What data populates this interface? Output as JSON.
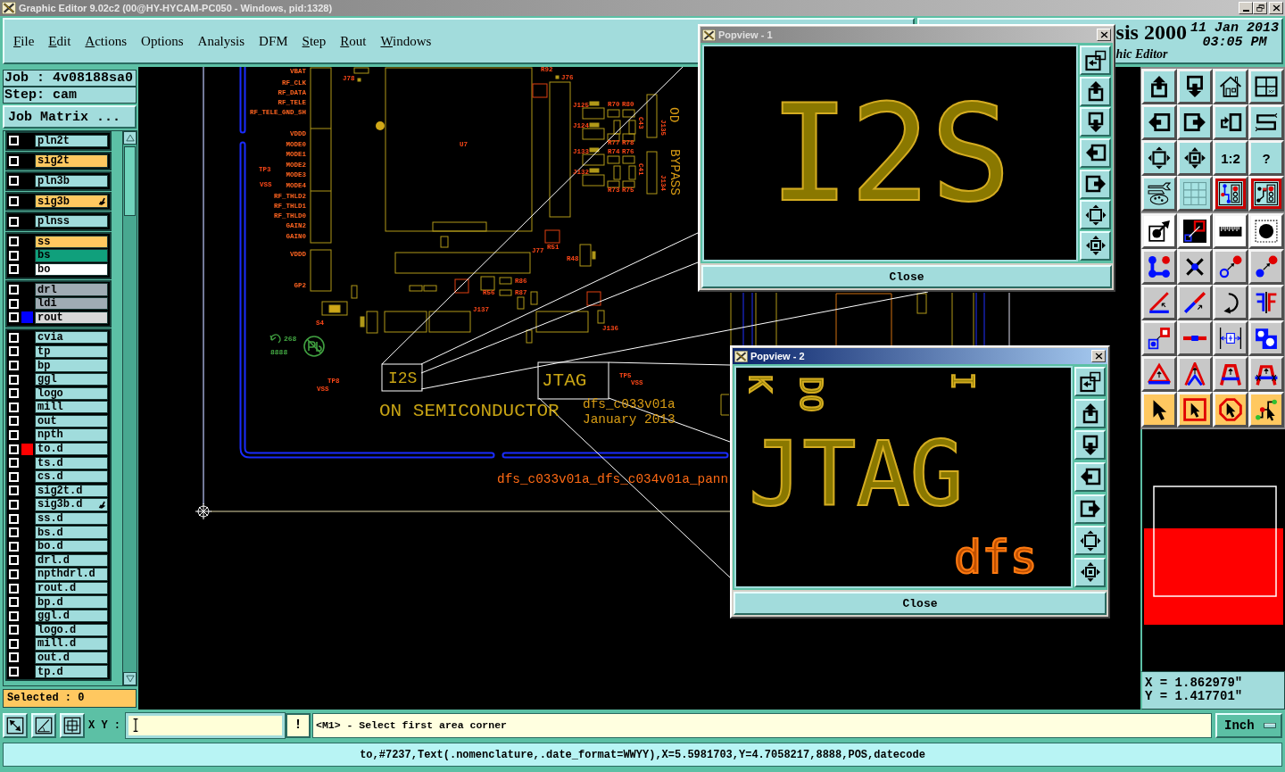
{
  "window": {
    "title": "Graphic Editor 9.02c2 (00@HY-HYCAM-PC050 - Windows, pid:1328)"
  },
  "menu": [
    {
      "label": "File",
      "mnemonic": true
    },
    {
      "label": "Edit",
      "mnemonic": true
    },
    {
      "label": "Actions",
      "mnemonic": true
    },
    {
      "label": "Options",
      "mnemonic": false
    },
    {
      "label": "Analysis",
      "mnemonic": false
    },
    {
      "label": "DFM",
      "mnemonic": false
    },
    {
      "label": "Step",
      "mnemonic": true
    },
    {
      "label": "Rout",
      "mnemonic": true
    },
    {
      "label": "Windows",
      "mnemonic": true
    }
  ],
  "branding": {
    "product": "sis 2000",
    "subtitle": "hic Editor",
    "date": "11 Jan 2013",
    "time": "03:05 PM"
  },
  "job_panel": {
    "job": "Job : 4v08188sa0",
    "step": "Step: cam",
    "matrix_button": "Job Matrix ..."
  },
  "layer_groups": [
    {
      "layers": [
        {
          "name": "pln2t",
          "color": "#a0dcdc",
          "checked": false,
          "marked": false
        }
      ]
    },
    {
      "layers": [
        {
          "name": "sig2t",
          "color": "#ffc860",
          "checked": false,
          "marked": false
        }
      ]
    },
    {
      "layers": [
        {
          "name": "pln3b",
          "color": "#a0dcdc",
          "checked": false,
          "marked": false
        }
      ]
    },
    {
      "layers": [
        {
          "name": "sig3b",
          "color": "#ffc860",
          "checked": false,
          "marked": true
        }
      ]
    },
    {
      "layers": [
        {
          "name": "plnss",
          "color": "#a0dcdc",
          "checked": false,
          "marked": false
        }
      ]
    },
    {
      "layers": [
        {
          "name": "ss",
          "color": "#ffc860",
          "checked": false,
          "marked": false
        },
        {
          "name": "bs",
          "color": "#10a07c",
          "checked": false,
          "marked": false
        },
        {
          "name": "bo",
          "color": "#ffffff",
          "checked": false,
          "marked": false
        }
      ]
    },
    {
      "layers": [
        {
          "name": "drl",
          "color": "#a0acb4",
          "checked": false,
          "marked": false
        },
        {
          "name": "ldi",
          "color": "#a0acb4",
          "checked": false,
          "marked": false
        },
        {
          "name": "rout",
          "color": "#d8d8d8",
          "checked": false,
          "marked": false,
          "swatch": {
            "color": "#0000ff"
          }
        }
      ]
    },
    {
      "layers": [
        {
          "name": "cvia",
          "color": "#a0dcdc",
          "checked": false,
          "marked": false
        },
        {
          "name": "tp",
          "color": "#a0dcdc",
          "checked": false,
          "marked": false
        },
        {
          "name": "bp",
          "color": "#a0dcdc",
          "checked": false,
          "marked": false
        },
        {
          "name": "ggl",
          "color": "#a0dcdc",
          "checked": false,
          "marked": false
        },
        {
          "name": "logo",
          "color": "#a0dcdc",
          "checked": false,
          "marked": false
        },
        {
          "name": "mill",
          "color": "#a0dcdc",
          "checked": false,
          "marked": false
        },
        {
          "name": "out",
          "color": "#a0dcdc",
          "checked": false,
          "marked": false
        },
        {
          "name": "npth",
          "color": "#a0dcdc",
          "checked": false,
          "marked": false
        },
        {
          "name": "to.d",
          "color": "#a0dcdc",
          "checked": false,
          "marked": false,
          "swatch": {
            "color": "#ff0000"
          }
        },
        {
          "name": "ts.d",
          "color": "#a0dcdc",
          "checked": false,
          "marked": false
        },
        {
          "name": "cs.d",
          "color": "#a0dcdc",
          "checked": false,
          "marked": false
        },
        {
          "name": "sig2t.d",
          "color": "#a0dcdc",
          "checked": false,
          "marked": false
        },
        {
          "name": "sig3b.d",
          "color": "#a0dcdc",
          "checked": false,
          "marked": true
        },
        {
          "name": "ss.d",
          "color": "#a0dcdc",
          "checked": false,
          "marked": false
        },
        {
          "name": "bs.d",
          "color": "#a0dcdc",
          "checked": false,
          "marked": false
        },
        {
          "name": "bo.d",
          "color": "#a0dcdc",
          "checked": false,
          "marked": false
        },
        {
          "name": "drl.d",
          "color": "#a0dcdc",
          "checked": false,
          "marked": false
        },
        {
          "name": "npthdrl.d",
          "color": "#a0dcdc",
          "checked": false,
          "marked": false
        },
        {
          "name": "rout.d",
          "color": "#a0dcdc",
          "checked": false,
          "marked": false
        },
        {
          "name": "bp.d",
          "color": "#a0dcdc",
          "checked": false,
          "marked": false
        },
        {
          "name": "ggl.d",
          "color": "#a0dcdc",
          "checked": false,
          "marked": false
        },
        {
          "name": "logo.d",
          "color": "#a0dcdc",
          "checked": false,
          "marked": false
        },
        {
          "name": "mill.d",
          "color": "#a0dcdc",
          "checked": false,
          "marked": false
        },
        {
          "name": "out.d",
          "color": "#a0dcdc",
          "checked": false,
          "marked": false
        },
        {
          "name": "tp.d",
          "color": "#a0dcdc",
          "checked": false,
          "marked": false
        }
      ]
    }
  ],
  "selection": "Selected : 0",
  "canvas": {
    "labels": [
      {
        "text": "VBAT",
        "kind": "pin"
      },
      {
        "text": "RF_CLK",
        "kind": "pin"
      },
      {
        "text": "RF_DATA",
        "kind": "pin"
      },
      {
        "text": "RF_TELE",
        "kind": "pin"
      },
      {
        "text": "RF_TELE_GND_SH",
        "kind": "pin"
      },
      {
        "text": "VDDD",
        "kind": "pin"
      },
      {
        "text": "MODE0",
        "kind": "pin"
      },
      {
        "text": "MODE1",
        "kind": "pin"
      },
      {
        "text": "MODE2",
        "kind": "pin"
      },
      {
        "text": "MODE3",
        "kind": "pin"
      },
      {
        "text": "MODE4",
        "kind": "pin"
      },
      {
        "text": "RF_THLD2",
        "kind": "pin"
      },
      {
        "text": "RF_THLD1",
        "kind": "pin"
      },
      {
        "text": "RF_THLD0",
        "kind": "pin"
      },
      {
        "text": "GAIN2",
        "kind": "pin"
      },
      {
        "text": "GAIN0",
        "kind": "pin"
      },
      {
        "text": "VDDD",
        "kind": "pin"
      },
      {
        "text": "GP2",
        "kind": "pin"
      },
      {
        "text": "TP3",
        "kind": "ref"
      },
      {
        "text": "VSS",
        "kind": "ref"
      },
      {
        "text": "J78",
        "kind": "ref"
      },
      {
        "text": "U7",
        "kind": "ref"
      },
      {
        "text": "R92",
        "kind": "ref"
      },
      {
        "text": "J76",
        "kind": "ref"
      },
      {
        "text": "J125",
        "kind": "ref"
      },
      {
        "text": "R70",
        "kind": "ref"
      },
      {
        "text": "R80",
        "kind": "ref"
      },
      {
        "text": "C43",
        "kind": "ref_vertical"
      },
      {
        "text": "J135",
        "kind": "ref_vertical"
      },
      {
        "text": "J124",
        "kind": "ref"
      },
      {
        "text": "R77",
        "kind": "ref"
      },
      {
        "text": "R78",
        "kind": "ref"
      },
      {
        "text": "J133",
        "kind": "ref"
      },
      {
        "text": "R74",
        "kind": "ref"
      },
      {
        "text": "R76",
        "kind": "ref"
      },
      {
        "text": "C41",
        "kind": "ref_vertical"
      },
      {
        "text": "J134",
        "kind": "ref_vertical"
      },
      {
        "text": "J132",
        "kind": "ref"
      },
      {
        "text": "R73",
        "kind": "ref"
      },
      {
        "text": "R75",
        "kind": "ref"
      },
      {
        "text": "OD",
        "kind": "vertical"
      },
      {
        "text": "BYPASS",
        "kind": "vertical"
      },
      {
        "text": "J77",
        "kind": "ref"
      },
      {
        "text": "R51",
        "kind": "ref"
      },
      {
        "text": "R48",
        "kind": "ref"
      },
      {
        "text": "R56",
        "kind": "ref"
      },
      {
        "text": "R86",
        "kind": "ref"
      },
      {
        "text": "R87",
        "kind": "ref"
      },
      {
        "text": "J137",
        "kind": "ref"
      },
      {
        "text": "J136",
        "kind": "ref"
      },
      {
        "text": "S4",
        "kind": "ref"
      },
      {
        "text": "268",
        "kind": "marking"
      },
      {
        "text": "8888",
        "kind": "marking"
      },
      {
        "text": "TP8",
        "kind": "ref"
      },
      {
        "text": "VSS",
        "kind": "ref"
      },
      {
        "text": "I2S",
        "kind": "silk"
      },
      {
        "text": "JTAG",
        "kind": "silk"
      },
      {
        "text": "TP5",
        "kind": "ref"
      },
      {
        "text": "VSS",
        "kind": "ref"
      },
      {
        "text": "ON SEMICONDUCTOR",
        "kind": "silk"
      },
      {
        "text": "dfs_c033v01a",
        "kind": "note"
      },
      {
        "text": "January 2013",
        "kind": "note"
      },
      {
        "text": "dfs_c033v01a_dfs_c034v01a_pann",
        "kind": "panel"
      }
    ]
  },
  "popviews": [
    {
      "title": "Popview - 1",
      "active": false,
      "view_texts": [
        {
          "text": "I2S",
          "kind": "large"
        }
      ],
      "close_button": "Close"
    },
    {
      "title": "Popview - 2",
      "active": true,
      "view_texts": [
        {
          "text": "K",
          "kind": "rotated"
        },
        {
          "text": "DO",
          "kind": "rotated"
        },
        {
          "text": "I",
          "kind": "rotated"
        },
        {
          "text": "JTAG",
          "kind": "large"
        },
        {
          "text": "dfs",
          "kind": "cut"
        }
      ],
      "close_button": "Close"
    }
  ],
  "view_tools": [
    {
      "kind": "view",
      "selected": false
    },
    {
      "kind": "view",
      "selected": false
    },
    {
      "kind": "view",
      "selected": false
    },
    {
      "kind": "view",
      "selected": false
    },
    {
      "kind": "view",
      "selected": false
    },
    {
      "kind": "view",
      "selected": false
    },
    {
      "kind": "view",
      "selected": false
    },
    {
      "kind": "view",
      "selected": false
    },
    {
      "kind": "view",
      "selected": false
    },
    {
      "kind": "view",
      "selected": false
    },
    {
      "kind": "view",
      "label": "1:2",
      "selected": false
    },
    {
      "kind": "view",
      "label": "?",
      "selected": false
    },
    {
      "kind": "view",
      "selected": false
    },
    {
      "kind": "view",
      "selected": false
    },
    {
      "kind": "view",
      "selected": true
    },
    {
      "kind": "view",
      "selected": true
    }
  ],
  "edit_tools": [
    {
      "kind": "measure",
      "selected": false
    },
    {
      "kind": "measure",
      "selected": false
    },
    {
      "kind": "measure",
      "selected": false
    },
    {
      "kind": "measure",
      "selected": false
    },
    {
      "kind": "edit",
      "selected": false
    },
    {
      "kind": "edit",
      "selected": false
    },
    {
      "kind": "edit",
      "selected": false
    },
    {
      "kind": "edit",
      "selected": false
    },
    {
      "kind": "edit",
      "selected": false
    },
    {
      "kind": "edit",
      "selected": false
    },
    {
      "kind": "edit",
      "selected": false
    },
    {
      "kind": "edit",
      "selected": false
    },
    {
      "kind": "edit",
      "selected": false
    },
    {
      "kind": "edit",
      "selected": false
    },
    {
      "kind": "edit",
      "selected": false
    },
    {
      "kind": "edit",
      "selected": false
    },
    {
      "kind": "edit",
      "selected": false
    },
    {
      "kind": "edit",
      "selected": false
    },
    {
      "kind": "edit",
      "selected": false
    },
    {
      "kind": "edit",
      "selected": false
    },
    {
      "kind": "select",
      "selected": false
    },
    {
      "kind": "select",
      "selected": false
    },
    {
      "kind": "select",
      "selected": false
    },
    {
      "kind": "select",
      "selected": false
    }
  ],
  "coordinates": {
    "x": "X = 1.862979\"",
    "y": "Y = 1.417701\""
  },
  "command_bar": {
    "xy_label": "X Y :",
    "bang_button": "!",
    "message": "<M1> - Select first area corner",
    "units": "Inch"
  },
  "status_bar": "to,#7237,Text(.nomenclature,.date_format=WWYY),X=5.5981703,Y=4.7058217,8888,POS,datecode"
}
